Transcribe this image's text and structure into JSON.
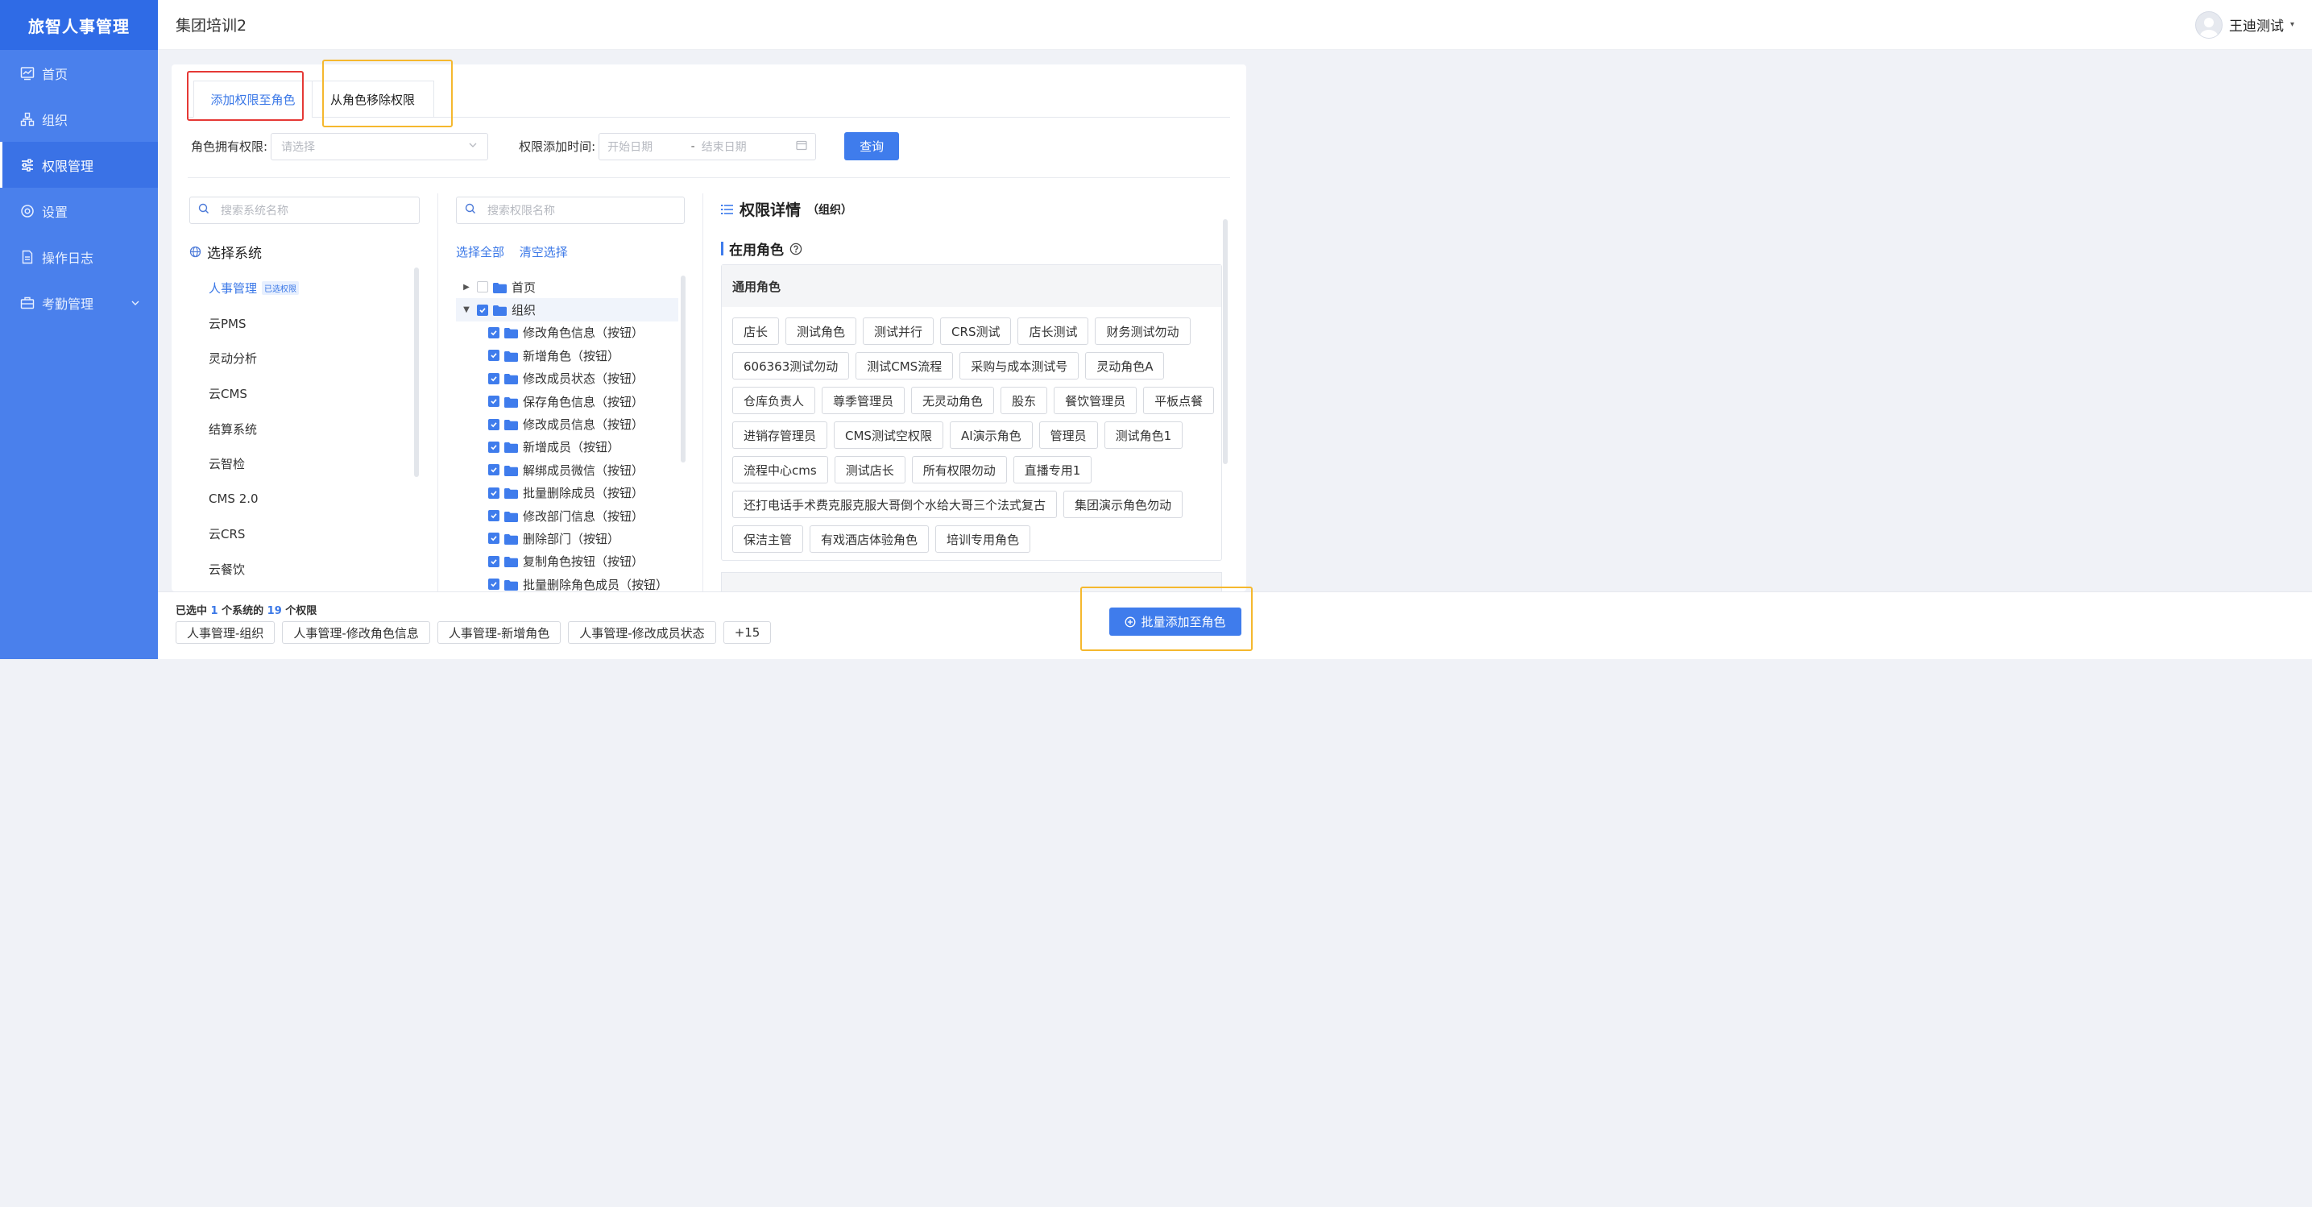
{
  "brand": "旅智人事管理",
  "sidebar": {
    "items": [
      {
        "label": "首页",
        "icon": "chart-icon"
      },
      {
        "label": "组织",
        "icon": "org-icon"
      },
      {
        "label": "权限管理",
        "icon": "sliders-icon"
      },
      {
        "label": "设置",
        "icon": "gear-icon"
      },
      {
        "label": "操作日志",
        "icon": "document-icon"
      },
      {
        "label": "考勤管理",
        "icon": "briefcase-icon"
      }
    ]
  },
  "header": {
    "title": "集团培训2",
    "user": "王迪测试"
  },
  "tabs": {
    "add": "添加权限至角色",
    "remove": "从角色移除权限"
  },
  "filter": {
    "role_label": "角色拥有权限:",
    "role_placeholder": "请选择",
    "time_label": "权限添加时间:",
    "start_placeholder": "开始日期",
    "separator": "-",
    "end_placeholder": "结束日期",
    "query": "查询"
  },
  "systems": {
    "search_placeholder": "搜索系统名称",
    "heading": "选择系统",
    "selected_badge": "已选权限",
    "items": [
      "人事管理",
      "云PMS",
      "灵动分析",
      "云CMS",
      "结算系统",
      "云智检",
      "CMS 2.0",
      "云CRS",
      "云餐饮"
    ]
  },
  "permissions": {
    "search_placeholder": "搜索权限名称",
    "select_all": "选择全部",
    "clear": "清空选择",
    "tree": [
      {
        "label": "首页",
        "level": 0,
        "checked": false,
        "expanded": false
      },
      {
        "label": "组织",
        "level": 0,
        "checked": true,
        "expanded": true
      },
      {
        "label": "修改角色信息（按钮）",
        "level": 1,
        "checked": true
      },
      {
        "label": "新增角色（按钮）",
        "level": 1,
        "checked": true
      },
      {
        "label": "修改成员状态（按钮）",
        "level": 1,
        "checked": true
      },
      {
        "label": "保存角色信息（按钮）",
        "level": 1,
        "checked": true
      },
      {
        "label": "修改成员信息（按钮）",
        "level": 1,
        "checked": true
      },
      {
        "label": "新增成员（按钮）",
        "level": 1,
        "checked": true
      },
      {
        "label": "解绑成员微信（按钮）",
        "level": 1,
        "checked": true
      },
      {
        "label": "批量删除成员（按钮）",
        "level": 1,
        "checked": true
      },
      {
        "label": "修改部门信息（按钮）",
        "level": 1,
        "checked": true
      },
      {
        "label": "删除部门（按钮）",
        "level": 1,
        "checked": true
      },
      {
        "label": "复制角色按钮（按钮）",
        "level": 1,
        "checked": true
      },
      {
        "label": "批量删除角色成员（按钮）",
        "level": 1,
        "checked": true
      }
    ]
  },
  "detail": {
    "title": "权限详情",
    "subtitle": "（组织）",
    "in_use": "在用角色",
    "group_title": "通用角色",
    "roles": [
      "店长",
      "测试角色",
      "测试并行",
      "CRS测试",
      "店长测试",
      "财务测试勿动",
      "606363测试勿动",
      "测试CMS流程",
      "采购与成本测试号",
      "灵动角色A",
      "仓库负责人",
      "尊季管理员",
      "无灵动角色",
      "股东",
      "餐饮管理员",
      "平板点餐",
      "进销存管理员",
      "CMS测试空权限",
      "AI演示角色",
      "管理员",
      "测试角色1",
      "流程中心cms",
      "测试店长",
      "所有权限勿动",
      "直播专用1",
      "还打电话手术费克服克服大哥倒个水给大哥三个法式复古",
      "集团演示角色勿动",
      "保洁主管",
      "有戏酒店体验角色",
      "培训专用角色"
    ]
  },
  "bottom": {
    "prefix": "已选中",
    "sys_count": "1",
    "mid": "个系统的",
    "perm_count": "19",
    "suffix": "个权限",
    "tags": [
      "人事管理-组织",
      "人事管理-修改角色信息",
      "人事管理-新增角色",
      "人事管理-修改成员状态"
    ],
    "more": "+15",
    "batch_add": "批量添加至角色"
  },
  "colors": {
    "brand": "#2f6be6",
    "sidebar": "#4a80ec",
    "primary": "#3f7cec",
    "annotation_red": "#e53935",
    "annotation_yellow": "#f5b82e"
  }
}
